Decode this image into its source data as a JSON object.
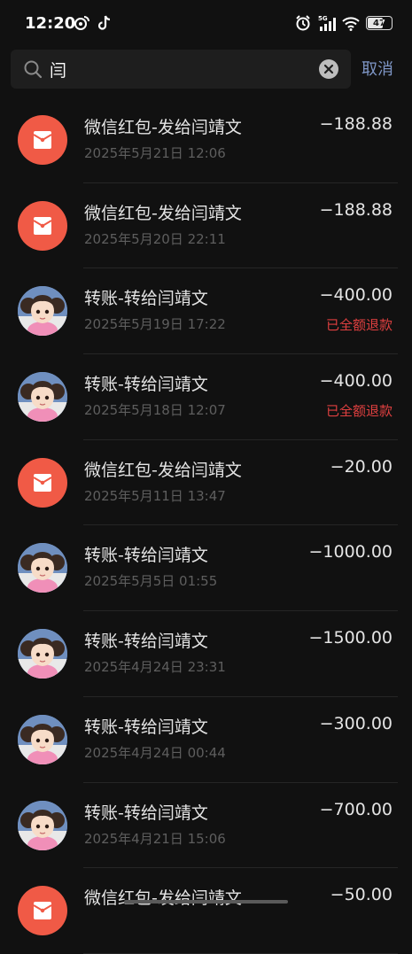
{
  "status_bar": {
    "time": "12:20",
    "battery": "47",
    "network": "5G"
  },
  "search": {
    "query": "闫",
    "cancel_label": "取消"
  },
  "transactions": [
    {
      "title": "微信红包-发给闫靖文",
      "date": "2025年5月21日 12:06",
      "amount": "−188.88",
      "status": "",
      "avatar": "red-packet-icon"
    },
    {
      "title": "微信红包-发给闫靖文",
      "date": "2025年5月20日 22:11",
      "amount": "−188.88",
      "status": "",
      "avatar": "red-packet-icon"
    },
    {
      "title": "转账-转给闫靖文",
      "date": "2025年5月19日 17:22",
      "amount": "−400.00",
      "status": "已全额退款",
      "avatar": "user-avatar"
    },
    {
      "title": "转账-转给闫靖文",
      "date": "2025年5月18日 12:07",
      "amount": "−400.00",
      "status": "已全额退款",
      "avatar": "user-avatar"
    },
    {
      "title": "微信红包-发给闫靖文",
      "date": "2025年5月11日 13:47",
      "amount": "−20.00",
      "status": "",
      "avatar": "red-packet-icon"
    },
    {
      "title": "转账-转给闫靖文",
      "date": "2025年5月5日 01:55",
      "amount": "−1000.00",
      "status": "",
      "avatar": "user-avatar"
    },
    {
      "title": "转账-转给闫靖文",
      "date": "2025年4月24日 23:31",
      "amount": "−1500.00",
      "status": "",
      "avatar": "user-avatar"
    },
    {
      "title": "转账-转给闫靖文",
      "date": "2025年4月24日 00:44",
      "amount": "−300.00",
      "status": "",
      "avatar": "user-avatar"
    },
    {
      "title": "转账-转给闫靖文",
      "date": "2025年4月21日 15:06",
      "amount": "−700.00",
      "status": "",
      "avatar": "user-avatar"
    },
    {
      "title": "微信红包-发给闫靖文",
      "date": "",
      "amount": "−50.00",
      "status": "",
      "avatar": "red-packet-icon"
    }
  ],
  "colors": {
    "background": "#111111",
    "red_packet": "#f05a46",
    "refund_text": "#e04040",
    "cancel_text": "#7f97c7"
  }
}
